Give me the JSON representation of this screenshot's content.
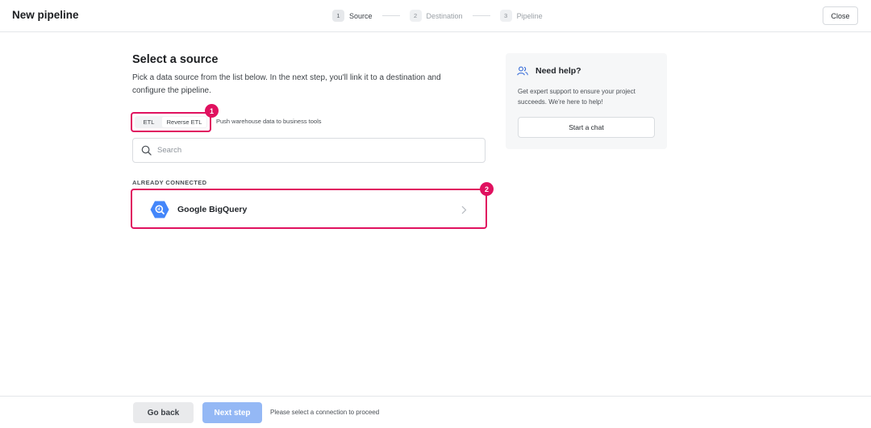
{
  "header": {
    "title": "New pipeline",
    "steps": [
      {
        "number": "1",
        "label": "Source"
      },
      {
        "number": "2",
        "label": "Destination"
      },
      {
        "number": "3",
        "label": "Pipeline"
      }
    ],
    "close_label": "Close"
  },
  "main": {
    "heading": "Select a source",
    "subheading": "Pick a data source from the list below. In the next step, you'll link it to a destination and configure the pipeline.",
    "toggle": {
      "etl_label": "ETL",
      "reverse_etl_label": "Reverse ETL",
      "selected": "Reverse ETL"
    },
    "toggle_hint": "Push warehouse data to business tools",
    "search": {
      "placeholder": "Search",
      "value": ""
    },
    "section_label": "ALREADY CONNECTED",
    "connections": [
      {
        "name": "Google BigQuery",
        "icon": "google-bigquery-icon"
      }
    ]
  },
  "annotations": {
    "badge_1": "1",
    "badge_2": "2"
  },
  "help": {
    "title": "Need help?",
    "text": "Get expert support to ensure your project succeeds. We're here to help!",
    "button_label": "Start a chat"
  },
  "footer": {
    "back_label": "Go back",
    "next_label": "Next step",
    "hint": "Please select a connection to proceed"
  },
  "colors": {
    "highlight": "#e0115f",
    "primary_disabled": "#94b8f5",
    "bigquery_blue": "#4386fa"
  }
}
